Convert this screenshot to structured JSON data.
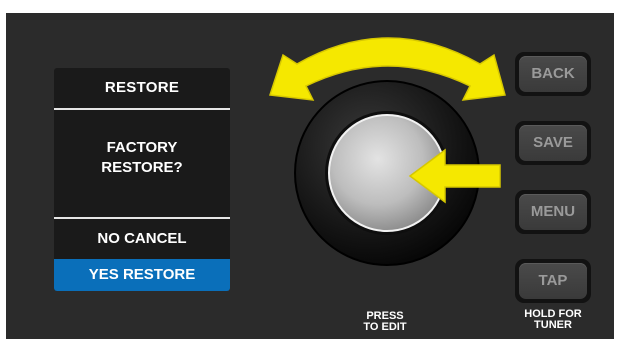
{
  "lcd": {
    "title": "RESTORE",
    "prompt_line1": "FACTORY",
    "prompt_line2": "RESTORE?",
    "option_no": "NO CANCEL",
    "option_yes": "YES RESTORE"
  },
  "buttons": {
    "back": "BACK",
    "save": "SAVE",
    "menu": "MENU",
    "tap": "TAP"
  },
  "captions": {
    "knob_line1": "PRESS",
    "knob_line2": "TO EDIT",
    "tap_line1": "HOLD FOR",
    "tap_line2": "TUNER"
  },
  "colors": {
    "panel": "#2b2b2b",
    "highlight": "#0a6fba",
    "arrow": "#f5e800"
  },
  "icons": {
    "rotate_arrow": "double-headed-curved-arrow-icon",
    "press_arrow": "left-arrow-icon"
  }
}
